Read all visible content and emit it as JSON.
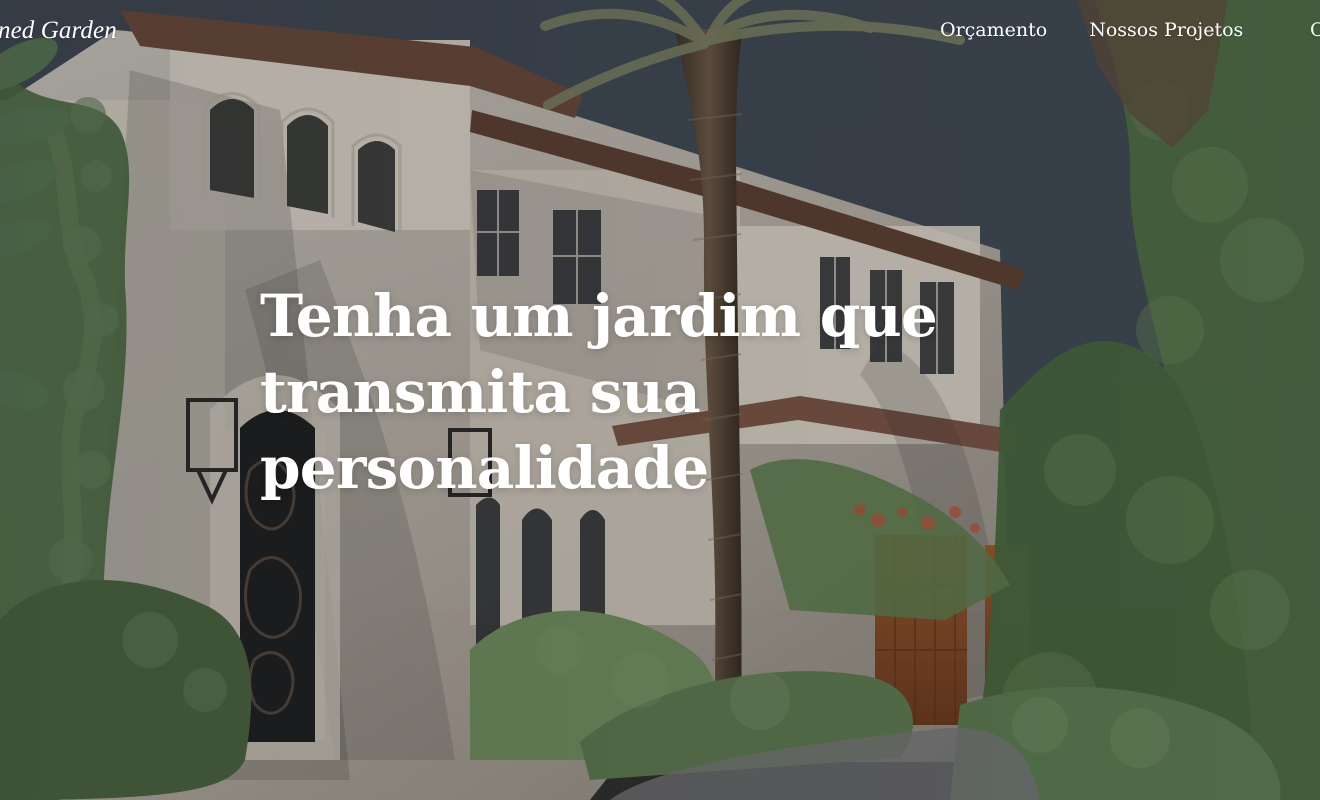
{
  "brand": {
    "visible_text": "ned Garden"
  },
  "nav": {
    "items": [
      {
        "label": "Orçamento"
      },
      {
        "label": "Nossos Projetos"
      }
    ],
    "clipped_item": "C"
  },
  "hero": {
    "headline": "Tenha um jardim que transmita sua personalidade"
  },
  "colors": {
    "text": "#ffffff",
    "sky": "#4c5563",
    "stone": "#d7d2c7",
    "roof": "#6b4b3f",
    "foliage": "#4e6a45",
    "wood": "#8a4f2b"
  },
  "icons": {
    "house_image": "mansion-photo",
    "palm_tree": "palm-tree-image",
    "plants": "foliage-image"
  }
}
